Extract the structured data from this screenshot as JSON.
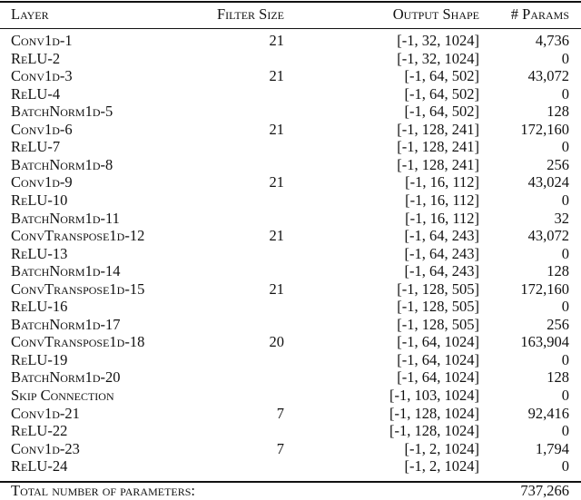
{
  "table": {
    "headers": {
      "layer": "Layer",
      "filter_size": "Filter Size",
      "output_shape": "Output Shape",
      "params": "# Params"
    },
    "rows": [
      {
        "layer": "Conv1d-1",
        "filter_size": "21",
        "output_shape": "[-1, 32, 1024]",
        "params": "4,736"
      },
      {
        "layer": "ReLU-2",
        "filter_size": "",
        "output_shape": "[-1, 32, 1024]",
        "params": "0"
      },
      {
        "layer": "Conv1d-3",
        "filter_size": "21",
        "output_shape": "[-1, 64, 502]",
        "params": "43,072"
      },
      {
        "layer": "ReLU-4",
        "filter_size": "",
        "output_shape": "[-1, 64, 502]",
        "params": "0"
      },
      {
        "layer": "BatchNorm1d-5",
        "filter_size": "",
        "output_shape": "[-1, 64, 502]",
        "params": "128"
      },
      {
        "layer": "Conv1d-6",
        "filter_size": "21",
        "output_shape": "[-1, 128, 241]",
        "params": "172,160"
      },
      {
        "layer": "ReLU-7",
        "filter_size": "",
        "output_shape": "[-1, 128, 241]",
        "params": "0"
      },
      {
        "layer": "BatchNorm1d-8",
        "filter_size": "",
        "output_shape": "[-1, 128, 241]",
        "params": "256"
      },
      {
        "layer": "Conv1d-9",
        "filter_size": "21",
        "output_shape": "[-1, 16, 112]",
        "params": "43,024"
      },
      {
        "layer": "ReLU-10",
        "filter_size": "",
        "output_shape": "[-1, 16, 112]",
        "params": "0"
      },
      {
        "layer": "BatchNorm1d-11",
        "filter_size": "",
        "output_shape": "[-1, 16, 112]",
        "params": "32"
      },
      {
        "layer": "ConvTranspose1d-12",
        "filter_size": "21",
        "output_shape": "[-1, 64, 243]",
        "params": "43,072"
      },
      {
        "layer": "ReLU-13",
        "filter_size": "",
        "output_shape": "[-1, 64, 243]",
        "params": "0"
      },
      {
        "layer": "BatchNorm1d-14",
        "filter_size": "",
        "output_shape": "[-1, 64, 243]",
        "params": "128"
      },
      {
        "layer": "ConvTranspose1d-15",
        "filter_size": "21",
        "output_shape": "[-1, 128, 505]",
        "params": "172,160"
      },
      {
        "layer": "ReLU-16",
        "filter_size": "",
        "output_shape": "[-1, 128, 505]",
        "params": "0"
      },
      {
        "layer": "BatchNorm1d-17",
        "filter_size": "",
        "output_shape": "[-1, 128, 505]",
        "params": "256"
      },
      {
        "layer": "ConvTranspose1d-18",
        "filter_size": "20",
        "output_shape": "[-1, 64, 1024]",
        "params": "163,904"
      },
      {
        "layer": "ReLU-19",
        "filter_size": "",
        "output_shape": "[-1, 64, 1024]",
        "params": "0"
      },
      {
        "layer": "BatchNorm1d-20",
        "filter_size": "",
        "output_shape": "[-1, 64, 1024]",
        "params": "128"
      },
      {
        "layer": "Skip Connection",
        "filter_size": "",
        "output_shape": "[-1, 103, 1024]",
        "params": "0"
      },
      {
        "layer": "Conv1d-21",
        "filter_size": "7",
        "output_shape": "[-1, 128, 1024]",
        "params": "92,416"
      },
      {
        "layer": "ReLU-22",
        "filter_size": "",
        "output_shape": "[-1, 128, 1024]",
        "params": "0"
      },
      {
        "layer": "Conv1d-23",
        "filter_size": "7",
        "output_shape": "[-1, 2, 1024]",
        "params": "1,794"
      },
      {
        "layer": "ReLU-24",
        "filter_size": "",
        "output_shape": "[-1, 2, 1024]",
        "params": "0"
      }
    ],
    "footer": {
      "label": "Total number of parameters:",
      "value": "737,266"
    }
  }
}
